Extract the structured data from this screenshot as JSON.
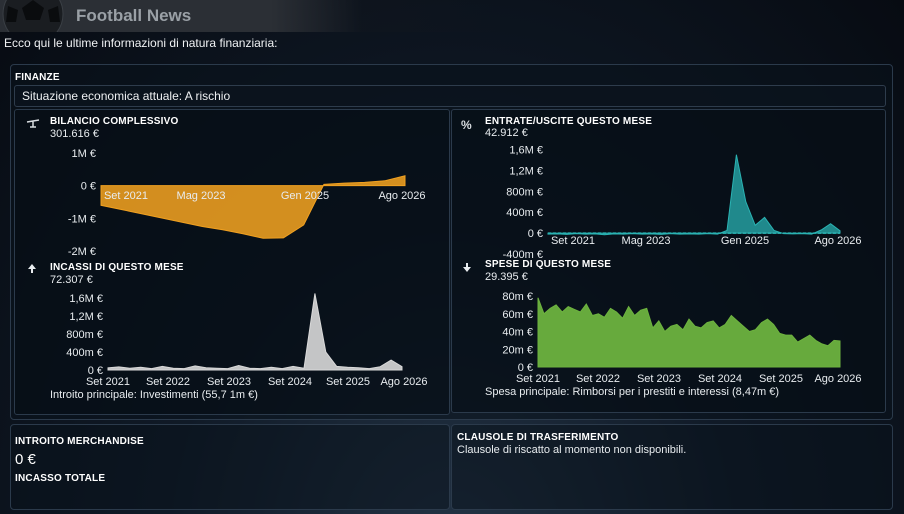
{
  "header": {
    "title": "Football News"
  },
  "intro": "Ecco qui le ultime informazioni di natura finanziaria:",
  "finanze": {
    "title": "FINANZE",
    "status": "Situazione economica attuale: A rischio"
  },
  "balance": {
    "title": "BILANCIO COMPLESSIVO",
    "value": "301.616 €",
    "y_ticks": [
      "1M €",
      "0 €",
      "-1M €",
      "-2M €"
    ],
    "x_ticks": [
      "Set 2021",
      "Mag 2023",
      "Gen 2025",
      "Ago 2026"
    ]
  },
  "cashflow": {
    "title": "ENTRATE/USCITE QUESTO MESE",
    "value": "42.912 €",
    "y_ticks": [
      "1,6M €",
      "1,2M €",
      "800m €",
      "400m €",
      "0 €",
      "-400m €"
    ],
    "x_ticks": [
      "Set 2021",
      "Mag 2023",
      "Gen 2025",
      "Ago 2026"
    ]
  },
  "income": {
    "title": "INCASSI DI QUESTO MESE",
    "value": "72.307 €",
    "y_ticks": [
      "1,6M €",
      "1,2M €",
      "800m €",
      "400m €",
      "0 €"
    ],
    "x_ticks": [
      "Set 2021",
      "Set 2022",
      "Set 2023",
      "Set 2024",
      "Set 2025",
      "Ago 2026"
    ],
    "footnote": "Introito principale: Investimenti (55,7 1m €)"
  },
  "expenses": {
    "title": "SPESE DI QUESTO MESE",
    "value": "29.395 €",
    "y_ticks": [
      "80m €",
      "60m €",
      "40m €",
      "20m €",
      "0 €"
    ],
    "x_ticks": [
      "Set 2021",
      "Set 2022",
      "Set 2023",
      "Set 2024",
      "Set 2025",
      "Ago 2026"
    ],
    "footnote": "Spesa principale: Rimborsi per i prestiti e interessi (8,47m €)"
  },
  "merch": {
    "title": "INTROITO MERCHANDISE",
    "value": "0 €",
    "label": "INCASSO TOTALE"
  },
  "transfer": {
    "title": "CLAUSOLE DI TRASFERIMENTO",
    "text": "Clausole di riscatto al momento non disponibili."
  },
  "colors": {
    "balance": "#f0a020",
    "cashflow": "#2ab3b3",
    "income": "#d9d9d9",
    "expenses": "#6db33f"
  },
  "icons": {
    "balance": "scale-icon",
    "cashflow": "percent-icon",
    "income": "arrow-up-icon",
    "expenses": "arrow-down-icon"
  },
  "chart_data": [
    {
      "type": "area",
      "title": "BILANCIO COMPLESSIVO",
      "x": [
        "Set 2021",
        "Mag 2023",
        "Gen 2025",
        "Ago 2026"
      ],
      "x_range": [
        "Set 2021",
        "Ago 2026"
      ],
      "ylim": [
        -2000000,
        1000000
      ],
      "series": [
        {
          "values": [
            -600000,
            -730000,
            -860000,
            -990000,
            -1120000,
            -1250000,
            -1350000,
            -1470000,
            -1610000,
            -1600000,
            -1200000,
            40000,
            80000,
            100000,
            150000,
            301616
          ]
        }
      ]
    },
    {
      "type": "area",
      "title": "ENTRATE/USCITE QUESTO MESE",
      "x": [
        "Set 2021",
        "Mag 2023",
        "Gen 2025",
        "Ago 2026"
      ],
      "ylim": [
        -400000,
        1800000
      ],
      "series": [
        {
          "values": [
            -20000,
            -15000,
            -25000,
            -10000,
            -20000,
            -15000,
            -30000,
            -15000,
            -20000,
            -10000,
            -20000,
            -15000,
            -25000,
            -10000,
            -20000,
            -15000,
            -20000,
            -10000,
            -20000,
            50000,
            1500000,
            600000,
            150000,
            300000,
            50000,
            -10000,
            -15000,
            -10000,
            -20000,
            60000,
            180000,
            42912
          ]
        }
      ]
    },
    {
      "type": "area",
      "title": "INCASSI DI QUESTO MESE",
      "x": [
        "Set 2021",
        "Set 2022",
        "Set 2023",
        "Set 2024",
        "Set 2025",
        "Ago 2026"
      ],
      "ylim": [
        0,
        1600000
      ],
      "series": [
        {
          "values": [
            50000,
            70000,
            40000,
            60000,
            30000,
            80000,
            40000,
            30000,
            90000,
            50000,
            40000,
            30000,
            100000,
            40000,
            30000,
            60000,
            30000,
            80000,
            40000,
            1700000,
            400000,
            80000,
            60000,
            50000,
            30000,
            72307,
            220000,
            72307
          ]
        }
      ]
    },
    {
      "type": "area",
      "title": "SPESE DI QUESTO MESE",
      "x": [
        "Set 2021",
        "Set 2022",
        "Set 2023",
        "Set 2024",
        "Set 2025",
        "Ago 2026"
      ],
      "ylim": [
        0,
        80000000
      ],
      "series": [
        {
          "values": [
            78000000,
            60000000,
            66000000,
            70000000,
            62000000,
            68000000,
            65000000,
            62000000,
            71000000,
            58000000,
            60000000,
            56000000,
            66000000,
            62000000,
            55000000,
            68000000,
            58000000,
            64000000,
            66000000,
            44000000,
            52000000,
            40000000,
            46000000,
            48000000,
            42000000,
            54000000,
            46000000,
            44000000,
            50000000,
            52000000,
            44000000,
            48000000,
            58000000,
            52000000,
            46000000,
            40000000,
            42000000,
            50000000,
            54000000,
            48000000,
            38000000,
            36000000,
            36000000,
            28000000,
            32000000,
            36000000,
            30000000,
            26000000,
            24000000,
            30000000,
            29395000
          ]
        }
      ]
    }
  ]
}
